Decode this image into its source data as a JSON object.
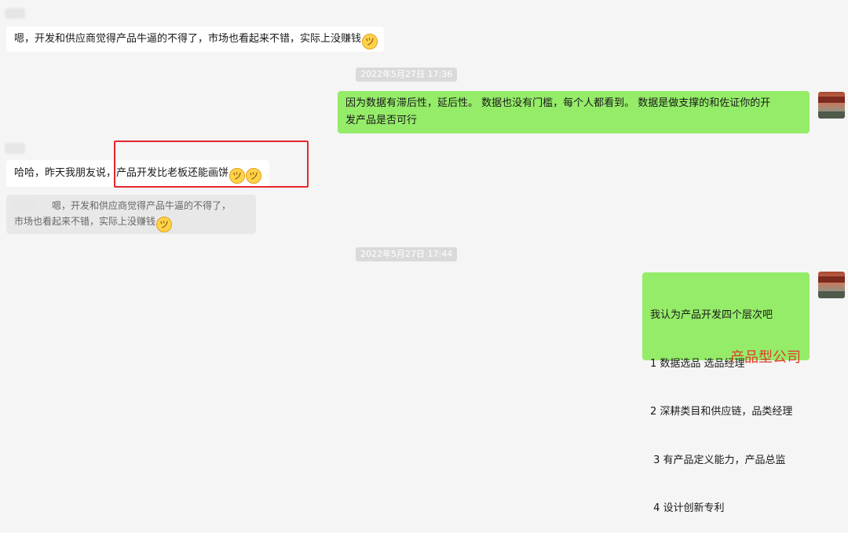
{
  "messages": {
    "m1": {
      "text": "嗯，开发和供应商觉得产品牛逼的不得了，市场也看起来不错，实际上没赚钱",
      "emoji": "grin-sweat-emoji"
    },
    "ts1": "2022年5月27日 17:36",
    "m2": {
      "lines": [
        "因为数据有滞后性，延后性。 数据也没有门槛，每个人都看到。 数据是做支撑的和佐证你的开",
        "发产品是否可行"
      ]
    },
    "m3": {
      "text_prefix": "哈哈，昨天我朋友说，",
      "text_highlight": "产品开发比老板还能画饼",
      "emoji": "grin-sweat-emoji"
    },
    "quote": {
      "lines": [
        "嗯，开发和供应商觉得产品牛逼的不得了，",
        "市场也看起来不错，实际上没赚钱"
      ]
    },
    "ts2": "2022年5月27日 17:44",
    "m4": {
      "lines": [
        "我认为产品开发四个层次吧",
        "1 数据选品 选品经理",
        "2 深耕类目和供应链，品类经理",
        " 3 有产品定义能力，产品总监",
        " 4 设计创新专利"
      ]
    }
  },
  "watermark": "产品型公司",
  "colors": {
    "background": "#f5f5f5",
    "self_bubble": "#95ec69",
    "other_bubble": "#ffffff",
    "highlight_border": "#e6262b",
    "watermark": "#e23a2e"
  }
}
